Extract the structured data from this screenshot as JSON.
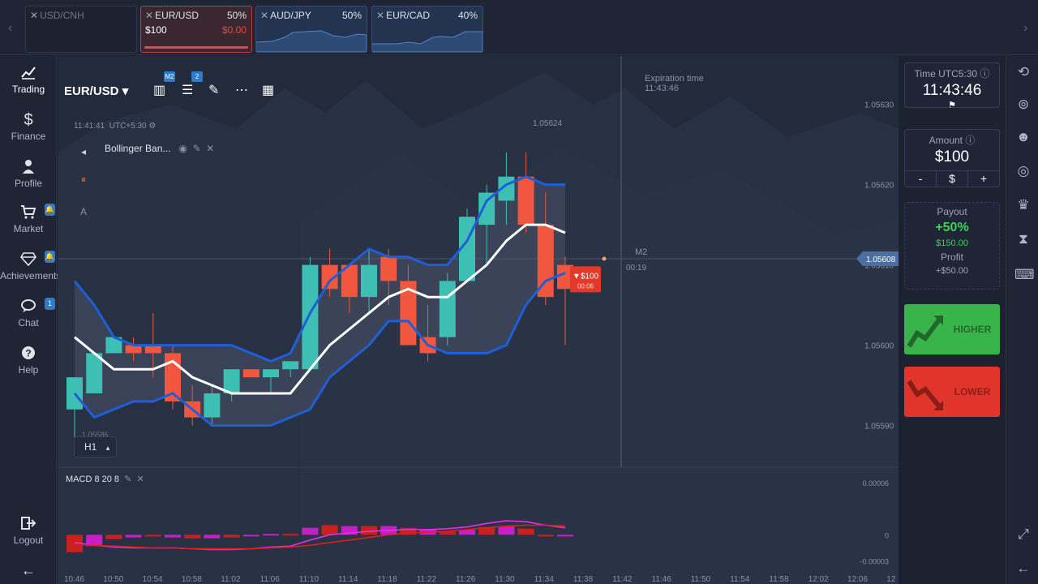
{
  "asset_tabs": [
    {
      "name": "USD/CNH",
      "pct": "",
      "state": "dim"
    },
    {
      "name": "EUR/USD",
      "pct": "50%",
      "amount": "$100",
      "pl": "$0.00",
      "state": "active"
    },
    {
      "name": "AUD/JPY",
      "pct": "50%",
      "state": "blue"
    },
    {
      "name": "EUR/CAD",
      "pct": "40%",
      "state": "blue"
    }
  ],
  "sidebar": {
    "items": [
      {
        "label": "Trading",
        "icon": "chart-line-icon"
      },
      {
        "label": "Finance",
        "icon": "dollar-icon"
      },
      {
        "label": "Profile",
        "icon": "user-icon"
      },
      {
        "label": "Market",
        "icon": "cart-icon",
        "badge": "🔔"
      },
      {
        "label": "Achievements",
        "icon": "diamond-icon",
        "badge": "🔔"
      },
      {
        "label": "Chat",
        "icon": "chat-icon",
        "badge": "1"
      },
      {
        "label": "Help",
        "icon": "help-icon"
      }
    ],
    "logout": "Logout"
  },
  "toolbar": {
    "pair": "EUR/USD",
    "badge_timeframe": "M2",
    "badge_indicators": "2"
  },
  "clock": {
    "time": "11:41:41",
    "tz": "UTC+5:30"
  },
  "indicator": {
    "name": "Bollinger Ban..."
  },
  "timeframe": "H1",
  "macd": {
    "label": "MACD 8 20 8"
  },
  "expiration": {
    "label": "Expiration time",
    "time": "11:43:46"
  },
  "high_label": "1.05624",
  "low_label": "1.05586",
  "marker": {
    "label": "M2",
    "countdown": "00:19"
  },
  "trade_marker": {
    "amount": "▼$100",
    "timer": "00:06"
  },
  "current_price": "1.05608",
  "price_ticks": [
    "1.05630",
    "1.05620",
    "1.05610",
    "1.05600",
    "1.05590"
  ],
  "macd_ticks": [
    "0.00006",
    "0",
    "-0.00003"
  ],
  "time_ticks": [
    "10:46",
    "10:50",
    "10:54",
    "10:58",
    "11:02",
    "11:06",
    "11:10",
    "11:14",
    "11:18",
    "11:22",
    "11:26",
    "11:30",
    "11:34",
    "11:38",
    "11:42",
    "11:46",
    "11:50",
    "11:54",
    "11:58",
    "12:02",
    "12:06",
    "12"
  ],
  "panel": {
    "time_label": "Time UTC5:30 ⓘ",
    "time": "11:43:46",
    "amount_label": "Amount ⓘ",
    "amount": "$100",
    "minus": "-",
    "currency": "$",
    "plus": "+",
    "payout_label": "Payout",
    "payout_pct": "+50%",
    "payout_val": "$150.00",
    "profit_label": "Profit",
    "profit_val": "+$50.00",
    "higher": "HIGHER",
    "lower": "LOWER"
  },
  "colors": {
    "up": "#3dbfb4",
    "down": "#f0573e",
    "band": "#1e5fd8",
    "mid": "#ffffff",
    "higher": "#38b44a",
    "lower": "#e1352c"
  },
  "chart_data": {
    "type": "candlestick",
    "timeframe": "H1",
    "candles": [
      {
        "o": 1.05592,
        "h": 1.05596,
        "l": 1.05588,
        "c": 1.05596
      },
      {
        "o": 1.05594,
        "h": 1.05599,
        "l": 1.05594,
        "c": 1.05599
      },
      {
        "o": 1.05599,
        "h": 1.05601,
        "l": 1.05599,
        "c": 1.05601
      },
      {
        "o": 1.056,
        "h": 1.05601,
        "l": 1.05598,
        "c": 1.05599
      },
      {
        "o": 1.056,
        "h": 1.05604,
        "l": 1.05596,
        "c": 1.05599
      },
      {
        "o": 1.05599,
        "h": 1.056,
        "l": 1.05592,
        "c": 1.05593
      },
      {
        "o": 1.05593,
        "h": 1.05595,
        "l": 1.0559,
        "c": 1.05591
      },
      {
        "o": 1.05591,
        "h": 1.05595,
        "l": 1.0559,
        "c": 1.05594
      },
      {
        "o": 1.05594,
        "h": 1.05597,
        "l": 1.05593,
        "c": 1.05597
      },
      {
        "o": 1.05597,
        "h": 1.05597,
        "l": 1.05596,
        "c": 1.05596
      },
      {
        "o": 1.05596,
        "h": 1.05597,
        "l": 1.05594,
        "c": 1.05597
      },
      {
        "o": 1.05597,
        "h": 1.05598,
        "l": 1.05596,
        "c": 1.05598
      },
      {
        "o": 1.05597,
        "h": 1.05611,
        "l": 1.05597,
        "c": 1.0561
      },
      {
        "o": 1.0561,
        "h": 1.05612,
        "l": 1.05606,
        "c": 1.05607
      },
      {
        "o": 1.0561,
        "h": 1.0561,
        "l": 1.05604,
        "c": 1.05606
      },
      {
        "o": 1.05606,
        "h": 1.05612,
        "l": 1.05604,
        "c": 1.0561
      },
      {
        "o": 1.05611,
        "h": 1.05612,
        "l": 1.05605,
        "c": 1.05608
      },
      {
        "o": 1.05608,
        "h": 1.0561,
        "l": 1.056,
        "c": 1.056
      },
      {
        "o": 1.05601,
        "h": 1.05605,
        "l": 1.05598,
        "c": 1.05599
      },
      {
        "o": 1.05601,
        "h": 1.05609,
        "l": 1.056,
        "c": 1.05608
      },
      {
        "o": 1.05608,
        "h": 1.05617,
        "l": 1.05608,
        "c": 1.05616
      },
      {
        "o": 1.05615,
        "h": 1.0562,
        "l": 1.0561,
        "c": 1.05619
      },
      {
        "o": 1.05618,
        "h": 1.05624,
        "l": 1.05615,
        "c": 1.05621
      },
      {
        "o": 1.05621,
        "h": 1.05624,
        "l": 1.05614,
        "c": 1.05615
      },
      {
        "o": 1.05615,
        "h": 1.05619,
        "l": 1.05605,
        "c": 1.05606
      },
      {
        "o": 1.0561,
        "h": 1.05611,
        "l": 1.056,
        "c": 1.05607
      }
    ],
    "bb_upper": [
      1.05608,
      1.05605,
      1.05601,
      1.056,
      1.056,
      1.056,
      1.056,
      1.056,
      1.056,
      1.05599,
      1.05598,
      1.05599,
      1.05604,
      1.05608,
      1.0561,
      1.05612,
      1.05611,
      1.05611,
      1.0561,
      1.0561,
      1.05613,
      1.05618,
      1.0562,
      1.05621,
      1.0562,
      1.0562
    ],
    "bb_middle": [
      1.05601,
      1.05599,
      1.05597,
      1.05597,
      1.05597,
      1.05598,
      1.05596,
      1.05595,
      1.05594,
      1.05594,
      1.05594,
      1.05594,
      1.05597,
      1.056,
      1.05602,
      1.05604,
      1.05606,
      1.05607,
      1.05606,
      1.05606,
      1.05608,
      1.0561,
      1.05613,
      1.05615,
      1.05615,
      1.05614
    ],
    "bb_lower": [
      1.05594,
      1.05591,
      1.05592,
      1.05593,
      1.05593,
      1.05594,
      1.05592,
      1.0559,
      1.0559,
      1.0559,
      1.0559,
      1.05591,
      1.05592,
      1.05596,
      1.05598,
      1.056,
      1.05603,
      1.05603,
      1.056,
      1.05599,
      1.05599,
      1.05599,
      1.056,
      1.05605,
      1.05608,
      1.05609
    ],
    "y_range": [
      1.05585,
      1.05633
    ],
    "macd_hist": [
      -2e-05,
      -1.3e-05,
      -5e-06,
      -3e-06,
      -2e-06,
      -3e-06,
      -4e-06,
      -4e-06,
      -3e-06,
      -1e-06,
      1e-06,
      1e-06,
      8e-06,
      1.1e-05,
      1e-05,
      1e-05,
      1e-05,
      8e-06,
      6e-06,
      4e-06,
      6e-06,
      9e-06,
      1e-05,
      7e-06,
      -1e-06,
      -2e-06
    ],
    "macd_line": [
      -9e-06,
      -1.2e-05,
      -1.4e-05,
      -1.5e-05,
      -1.5e-05,
      -1.5e-05,
      -1.6e-05,
      -1.7e-05,
      -1.7e-05,
      -1.6e-05,
      -1.4e-05,
      -1.3e-05,
      -6e-06,
      0.0,
      2e-06,
      4e-06,
      5e-06,
      6e-06,
      6e-06,
      7e-06,
      9e-06,
      1.3e-05,
      1.6e-05,
      1.5e-05,
      1.1e-05,
      8e-06
    ],
    "signal_line": [
      -1.1e-05,
      -1.2e-05,
      -1.3e-05,
      -1.4e-05,
      -1.5e-05,
      -1.5e-05,
      -1.6e-05,
      -1.6e-05,
      -1.6e-05,
      -1.6e-05,
      -1.5e-05,
      -1.4e-05,
      -1.2e-05,
      -9e-06,
      -6e-06,
      -3e-06,
      0.0,
      2e-06,
      3e-06,
      4e-06,
      6e-06,
      8e-06,
      1e-05,
      1.1e-05,
      1.1e-05,
      1e-05
    ],
    "macd_range": [
      -3.5e-05,
      7e-05
    ]
  }
}
